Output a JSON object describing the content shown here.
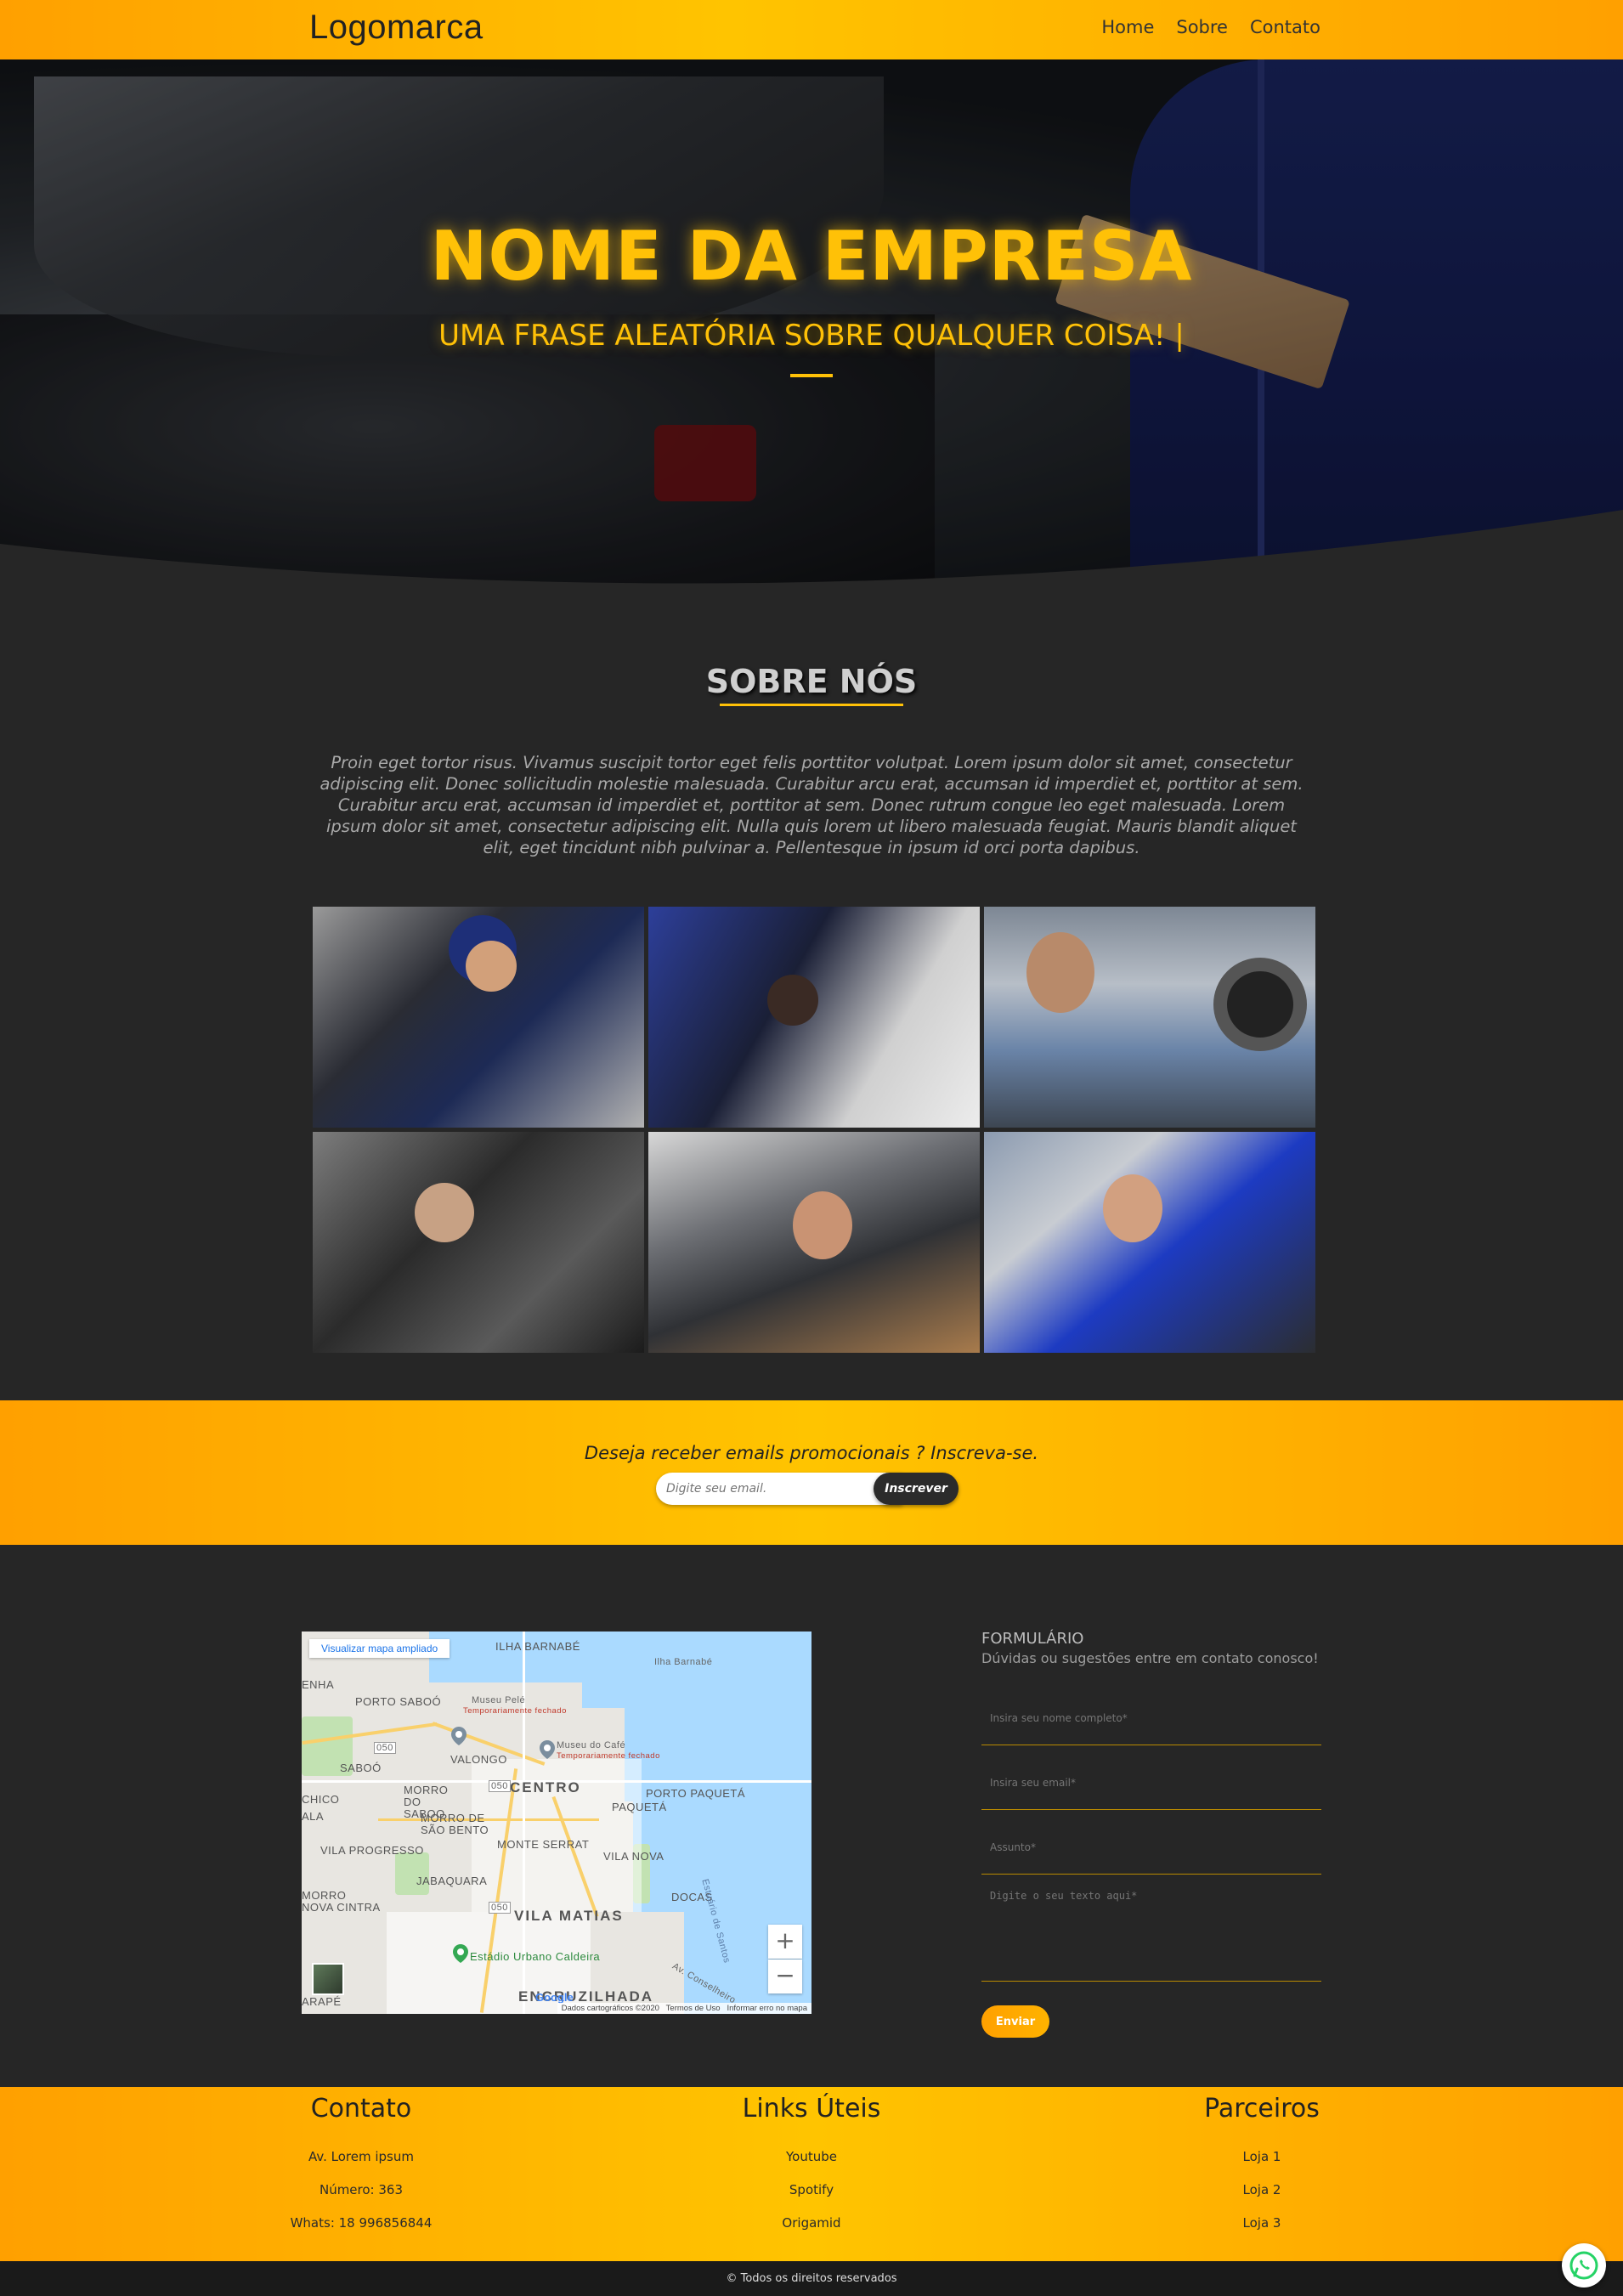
{
  "header": {
    "logo": "Logomarca",
    "nav": [
      "Home",
      "Sobre",
      "Contato"
    ]
  },
  "hero": {
    "title": "NOME DA EMPRESA",
    "subtitle": "UMA FRASE ALEATÓRIA SOBRE QUALQUER COISA! |"
  },
  "about": {
    "title": "SOBRE NÓS",
    "text": "Proin eget tortor risus. Vivamus suscipit tortor eget felis porttitor volutpat. Lorem ipsum dolor sit amet, consectetur adipiscing elit. Donec sollicitudin molestie malesuada. Curabitur arcu erat, accumsan id imperdiet et, porttitor at sem. Curabitur arcu erat, accumsan id imperdiet et, porttitor at sem. Donec rutrum congue leo eget malesuada. Lorem ipsum dolor sit amet, consectetur adipiscing elit. Nulla quis lorem ut libero malesuada feugiat. Mauris blandit aliquet elit, eget tincidunt nibh pulvinar a. Pellentesque in ipsum id orci porta dapibus."
  },
  "newsletter": {
    "text": "Deseja receber emails promocionais ? Inscreva-se.",
    "placeholder": "Digite seu email.",
    "button": "Inscrever"
  },
  "map": {
    "link": "Visualizar mapa ampliado",
    "labels": {
      "ilha_barnabe_top": "ILHA BARNABÉ",
      "ilha_barnabe": "Ilha Barnabé",
      "enha": "ENHA",
      "porto_saboo": "PORTO SABOÓ",
      "museu_pele": "Museu Pelé",
      "museu_pele_status": "Temporariamente fechado",
      "museu_cafe": "Museu do Café",
      "museu_cafe_status": "Temporariamente fechado",
      "valongo": "VALONGO",
      "saboo": "SABOÓ",
      "centro": "CENTRO",
      "porto_paqueta": "PORTO PAQUETÁ",
      "paqueta": "PAQUETÁ",
      "chico": "CHICO",
      "morro_saboo": "MORRO DO SABOO",
      "ala": "ALA",
      "morro_sao_bento": "MORRO DE SÃO BENTO",
      "monte_serrat": "MONTE SERRAT",
      "vila_progresso": "VILA PROGRESSO",
      "vila_nova": "VILA NOVA",
      "jabaquara": "JABAQUARA",
      "docas": "DOCAS",
      "morro": "MORRO",
      "nova_cintra": "NOVA CINTRA",
      "vila_matias": "VILA MATIAS",
      "estuario": "Estuário de Santos",
      "estadio": "Estádio Urbano Caldeira",
      "av": "Av. Conselheiro...",
      "encruzilhada": "ENCRUZILHADA",
      "arape": "ARAPÉ",
      "route1": "050",
      "route2": "050",
      "route3": "050"
    },
    "zoom_in": "+",
    "zoom_out": "−",
    "footer_data": "Dados cartográficos ©2020",
    "footer_terms": "Termos de Uso",
    "footer_report": "Informar erro no mapa",
    "google": "Google"
  },
  "form": {
    "title": "FORMULÁRIO",
    "subtitle": "Dúvidas ou sugestões entre em contato conosco!",
    "name_placeholder": "Insira seu nome completo*",
    "email_placeholder": "Insira seu email*",
    "subject_placeholder": "Assunto*",
    "message_placeholder": "Digite o seu texto aqui*",
    "submit": "Enviar"
  },
  "footer": {
    "contact": {
      "title": "Contato",
      "items": [
        "Av. Lorem ipsum",
        "Número: 363",
        "Whats: 18 996856844"
      ]
    },
    "links": {
      "title": "Links Úteis",
      "items": [
        "Youtube",
        "Spotify",
        "Origamid"
      ]
    },
    "partners": {
      "title": "Parceiros",
      "items": [
        "Loja 1",
        "Loja 2",
        "Loja 3"
      ]
    },
    "copyright": "© Todos os direitos reservados"
  },
  "colors": {
    "accent": "#ffc107",
    "accent_dark": "#ffa000",
    "background": "#262626"
  },
  "icons": {
    "whatsapp": "whatsapp-icon"
  }
}
